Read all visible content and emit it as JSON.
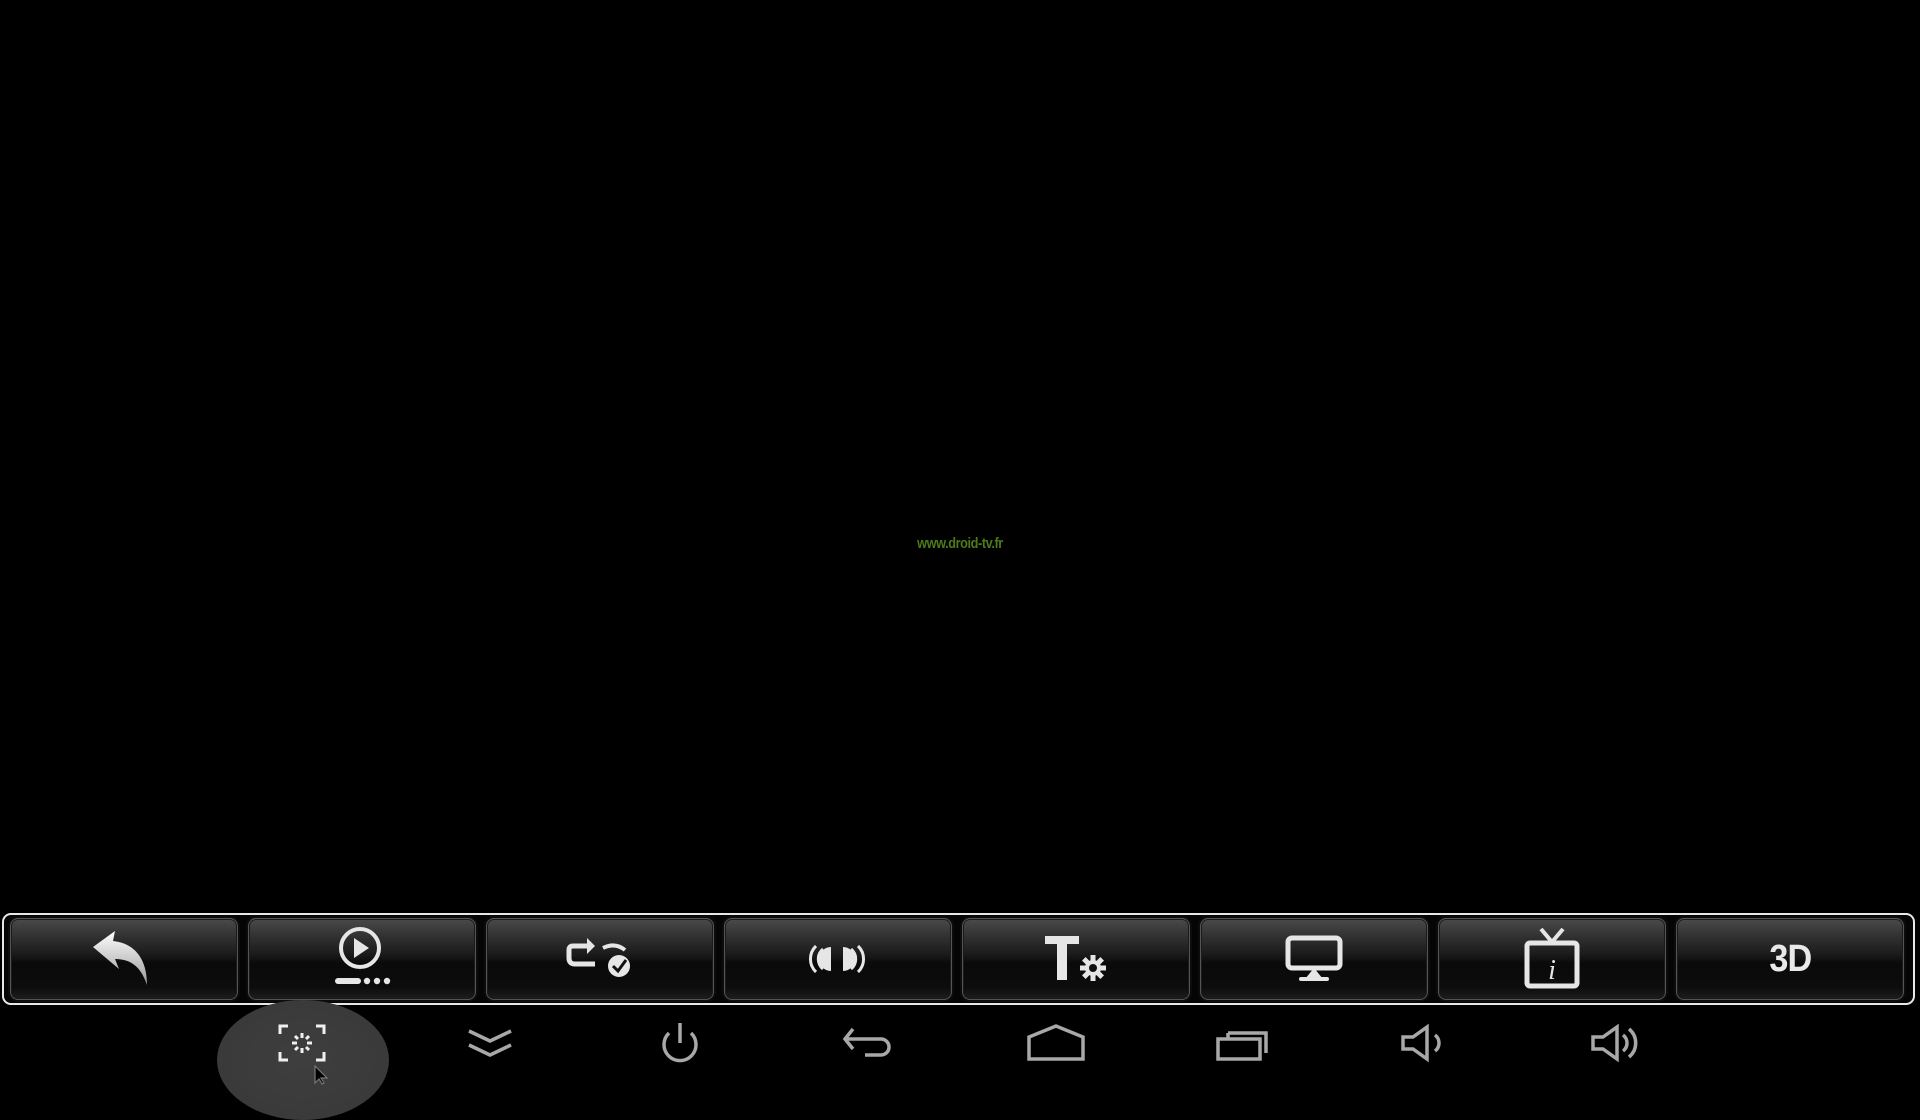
{
  "watermark": "www.droid-tv.fr",
  "toolbar": {
    "buttons": [
      {
        "name": "back",
        "icon": "curved-back-arrow-icon"
      },
      {
        "name": "playback-mode",
        "icon": "play-circle-progress-icon"
      },
      {
        "name": "repeat-mode",
        "icon": "repeat-check-icon"
      },
      {
        "name": "audio-track",
        "icon": "surround-sound-icon"
      },
      {
        "name": "subtitle-settings",
        "icon": "text-gear-icon"
      },
      {
        "name": "display-mode",
        "icon": "monitor-icon"
      },
      {
        "name": "tv-info",
        "icon": "tv-info-icon"
      },
      {
        "name": "3d-mode",
        "icon": "3d-text",
        "label": "3D"
      }
    ]
  },
  "navbar": {
    "items": [
      {
        "name": "screenshot",
        "icon": "screenshot-icon",
        "active": true
      },
      {
        "name": "hide-bar",
        "icon": "double-chevron-down-icon"
      },
      {
        "name": "power",
        "icon": "power-icon"
      },
      {
        "name": "back",
        "icon": "back-arrow-icon"
      },
      {
        "name": "home",
        "icon": "home-icon"
      },
      {
        "name": "recent-apps",
        "icon": "recent-apps-icon"
      },
      {
        "name": "volume-down",
        "icon": "volume-down-icon"
      },
      {
        "name": "volume-up",
        "icon": "volume-up-icon"
      }
    ]
  },
  "colors": {
    "watermark": "#4d7a1a",
    "icon": "#e6e6e6",
    "nav_icon": "#a8a8a8",
    "highlight": "#3a3a3a"
  }
}
